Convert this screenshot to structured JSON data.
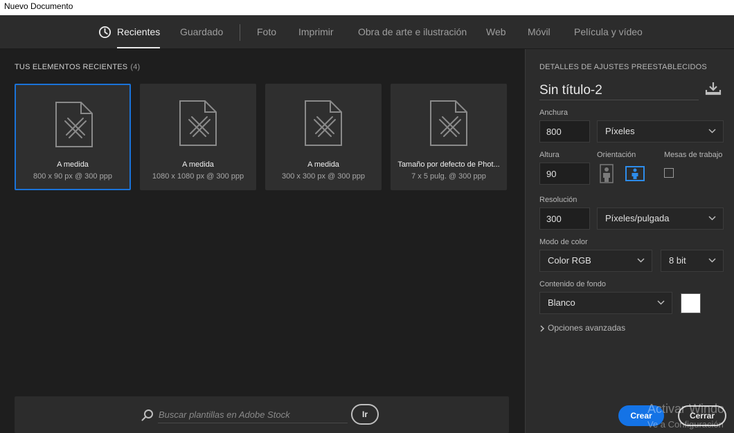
{
  "window": {
    "title": "Nuevo Documento"
  },
  "tabs": [
    {
      "label": "Recientes",
      "active": true
    },
    {
      "label": "Guardado"
    },
    {
      "label": "Foto"
    },
    {
      "label": "Imprimir"
    },
    {
      "label": "Obra de arte e ilustración"
    },
    {
      "label": "Web"
    },
    {
      "label": "Móvil"
    },
    {
      "label": "Película y vídeo"
    }
  ],
  "recent": {
    "title": "TUS ELEMENTOS RECIENTES",
    "count": "(4)",
    "items": [
      {
        "name": "A medida",
        "meta": "800 x 90 px @ 300 ppp",
        "selected": true
      },
      {
        "name": "A medida",
        "meta": "1080 x 1080 px @ 300 ppp"
      },
      {
        "name": "A medida",
        "meta": "300 x 300 px @ 300 ppp"
      },
      {
        "name": "Tamaño por defecto de Phot...",
        "meta": "7 x 5 pulg. @ 300 ppp"
      }
    ]
  },
  "search": {
    "placeholder": "Buscar plantillas en Adobe Stock",
    "go_label": "Ir"
  },
  "details": {
    "title": "DETALLES DE AJUSTES PREESTABLECIDOS",
    "doc_name": "Sin título-2",
    "width_label": "Anchura",
    "width_value": "800",
    "width_unit": "Píxeles",
    "height_label": "Altura",
    "height_value": "90",
    "orientation_label": "Orientación",
    "orientation_selected": "landscape",
    "artboards_label": "Mesas de trabajo",
    "artboards_checked": false,
    "resolution_label": "Resolución",
    "resolution_value": "300",
    "resolution_unit": "Píxeles/pulgada",
    "color_mode_label": "Modo de color",
    "color_mode": "Color RGB",
    "bit_depth": "8 bit",
    "background_label": "Contenido de fondo",
    "background": "Blanco",
    "background_color": "#ffffff",
    "advanced_label": "Opciones avanzadas"
  },
  "actions": {
    "create_label": "Crear",
    "close_label": "Cerrar"
  },
  "watermark": {
    "line1": "Activar Windo",
    "line2": "Ve a Configuración"
  },
  "colors": {
    "accent": "#1473e6",
    "selected_border": "#1a73d9",
    "orientation_active": "#2d8ceb"
  }
}
